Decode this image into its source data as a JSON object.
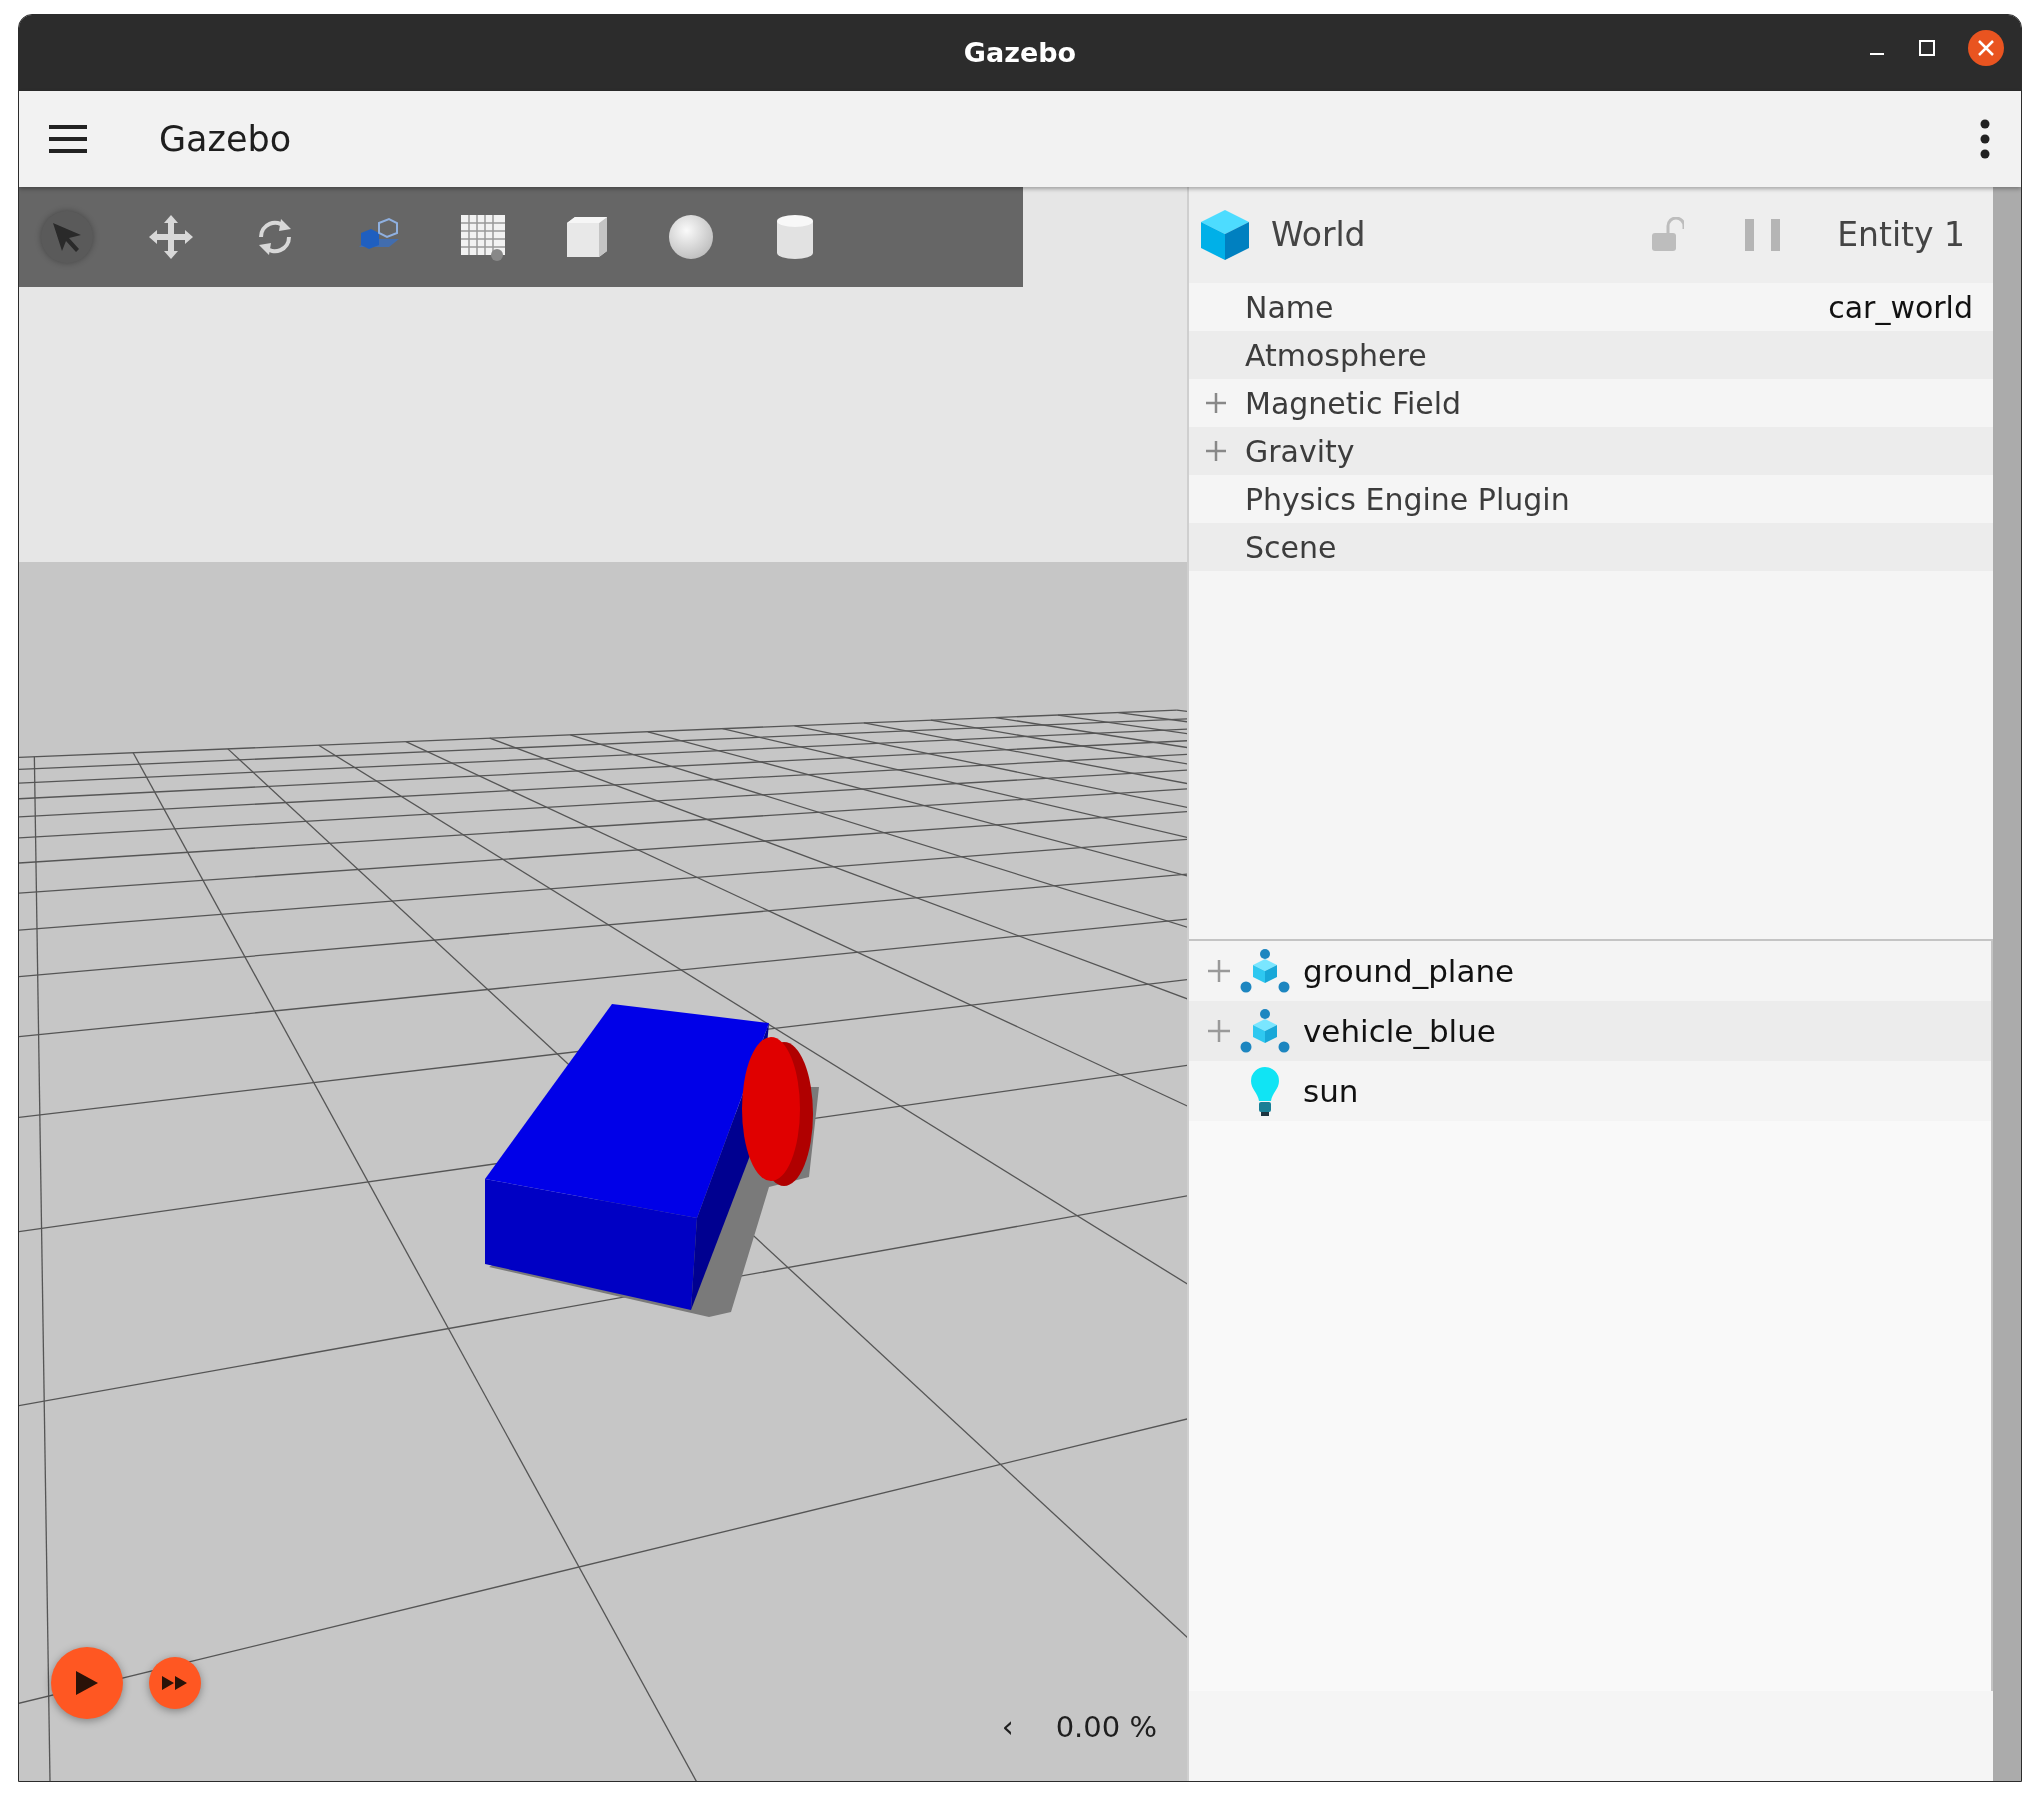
{
  "window": {
    "title": "Gazebo"
  },
  "app_bar": {
    "title": "Gazebo"
  },
  "toolbar": {
    "tools": [
      {
        "kind": "select",
        "selected": true
      },
      {
        "kind": "translate",
        "selected": false
      },
      {
        "kind": "rotate",
        "selected": false
      },
      {
        "kind": "transform",
        "selected": false
      },
      {
        "kind": "grid",
        "selected": false
      },
      {
        "kind": "box",
        "selected": false
      },
      {
        "kind": "sphere",
        "selected": false
      },
      {
        "kind": "cylinder",
        "selected": false
      }
    ]
  },
  "playback": {
    "playing": false,
    "rtf": "0.00 %",
    "collapse": "‹"
  },
  "component_inspector": {
    "entity_type": "World",
    "entity_label": "Entity 1",
    "locked": false,
    "paused": true,
    "properties": [
      {
        "label": "Name",
        "value": "car_world",
        "expandable": false
      },
      {
        "label": "Atmosphere",
        "expandable": false
      },
      {
        "label": "Magnetic Field",
        "expandable": true
      },
      {
        "label": "Gravity",
        "expandable": true
      },
      {
        "label": "Physics Engine Plugin",
        "expandable": false
      },
      {
        "label": "Scene",
        "expandable": false
      }
    ]
  },
  "entity_tree": {
    "items": [
      {
        "name": "ground_plane",
        "kind": "model",
        "expandable": true
      },
      {
        "name": "vehicle_blue",
        "kind": "model",
        "expandable": true
      },
      {
        "name": "sun",
        "kind": "light",
        "expandable": false
      }
    ]
  }
}
